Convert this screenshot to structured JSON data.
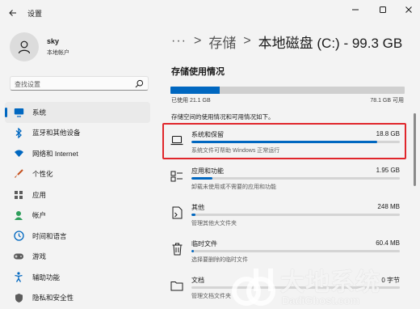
{
  "window": {
    "title": "设置"
  },
  "profile": {
    "name": "sky",
    "account_type": "本地帐户"
  },
  "search": {
    "placeholder": "查找设置"
  },
  "sidebar": {
    "items": [
      {
        "label": "系统",
        "icon": "monitor-icon",
        "color": "#0067c0"
      },
      {
        "label": "蓝牙和其他设备",
        "icon": "bluetooth-icon",
        "color": "#0067c0"
      },
      {
        "label": "网络和 Internet",
        "icon": "wifi-icon",
        "color": "#0067c0"
      },
      {
        "label": "个性化",
        "icon": "brush-icon",
        "color": "#c5521f"
      },
      {
        "label": "应用",
        "icon": "apps-icon",
        "color": "#5c5c5c"
      },
      {
        "label": "帐户",
        "icon": "person-icon",
        "color": "#2e9e5b"
      },
      {
        "label": "时间和语言",
        "icon": "globe-clock-icon",
        "color": "#0067c0"
      },
      {
        "label": "游戏",
        "icon": "gamepad-icon",
        "color": "#5c5c5c"
      },
      {
        "label": "辅助功能",
        "icon": "accessibility-icon",
        "color": "#0067c0"
      },
      {
        "label": "隐私和安全性",
        "icon": "shield-icon",
        "color": "#5c5c5c"
      }
    ]
  },
  "breadcrumb": {
    "dots": "···",
    "separator": ">",
    "parent": "存储",
    "current": "本地磁盘 (C:) - 99.3 GB"
  },
  "storage": {
    "section_title": "存储使用情况",
    "used_label": "已使用 21.1 GB",
    "free_label": "78.1 GB 可用",
    "used_fraction": 0.21,
    "description": "存储空间的使用情况和可用情况如下。"
  },
  "categories": [
    {
      "name": "系统和保留",
      "size": "18.8 GB",
      "description": "系统文件可帮助 Windows 正常运行",
      "fraction": 0.89,
      "icon": "laptop-icon",
      "highlighted": true
    },
    {
      "name": "应用和功能",
      "size": "1.95 GB",
      "description": "卸载未使用或不需要的应用和功能",
      "fraction": 0.1,
      "icon": "apps-icon",
      "highlighted": false
    },
    {
      "name": "其他",
      "size": "248 MB",
      "description": "管理其他大文件夹",
      "fraction": 0.02,
      "icon": "document-icon",
      "highlighted": false
    },
    {
      "name": "临时文件",
      "size": "60.4 MB",
      "description": "选择要删除的临时文件",
      "fraction": 0.01,
      "icon": "trash-icon",
      "highlighted": false
    },
    {
      "name": "文档",
      "size": "0 字节",
      "description": "管理文档文件夹",
      "fraction": 0.0,
      "icon": "folder-icon",
      "highlighted": false
    }
  ],
  "watermark": {
    "cn": "大地系统",
    "en": "DadiGhost.com"
  },
  "colors": {
    "accent": "#0067c0",
    "highlight_border": "#e0262b"
  }
}
